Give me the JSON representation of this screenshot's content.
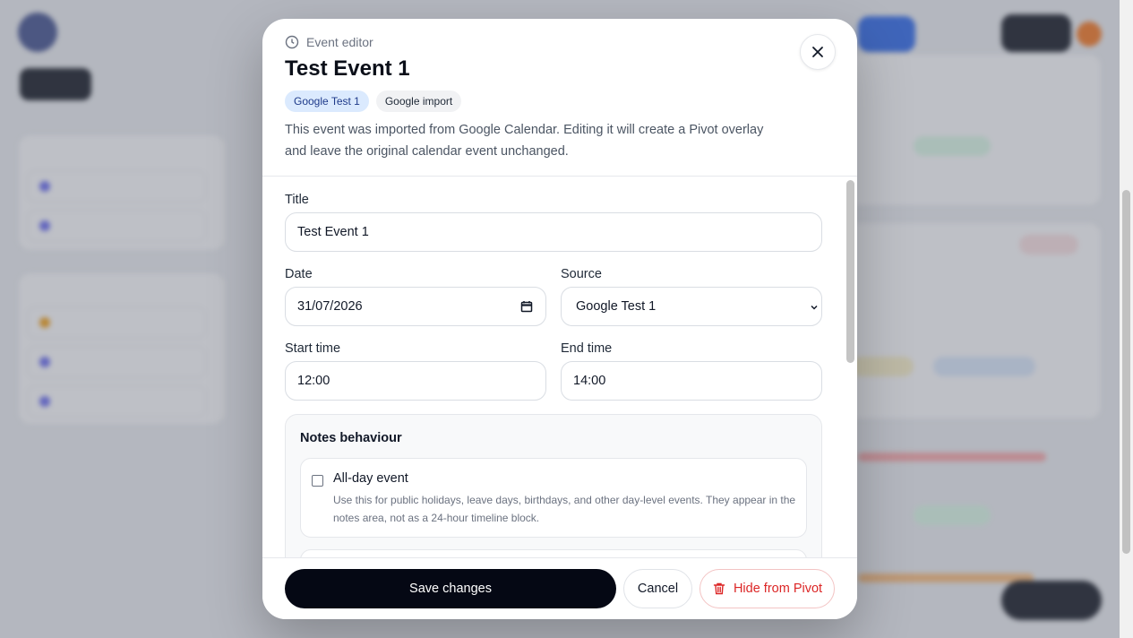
{
  "modal": {
    "eyebrow": "Event editor",
    "title": "Test Event 1",
    "badges": [
      "Google Test 1",
      "Google import"
    ],
    "description": "This event was imported from Google Calendar. Editing it will create a Pivot overlay and leave the original calendar event unchanged.",
    "close_icon": "close-icon"
  },
  "form": {
    "title_label": "Title",
    "title_value": "Test Event 1",
    "date_label": "Date",
    "date_value": "31/07/2026",
    "source_label": "Source",
    "source_value": "Google Test 1",
    "start_label": "Start time",
    "start_value": "12:00",
    "end_label": "End time",
    "end_value": "14:00"
  },
  "notes": {
    "title": "Notes behaviour",
    "allday_label": "All-day event",
    "allday_help": "Use this for public holidays, leave days, birthdays, and other day-level events. They appear in the notes area, not as a 24-hour timeline block.",
    "allday_checked": false
  },
  "footer": {
    "save_label": "Save changes",
    "cancel_label": "Cancel",
    "hide_label": "Hide from Pivot"
  },
  "colors": {
    "primary_button": "#050814",
    "danger": "#dc2626",
    "badge_blue_bg": "#dbeafe"
  }
}
